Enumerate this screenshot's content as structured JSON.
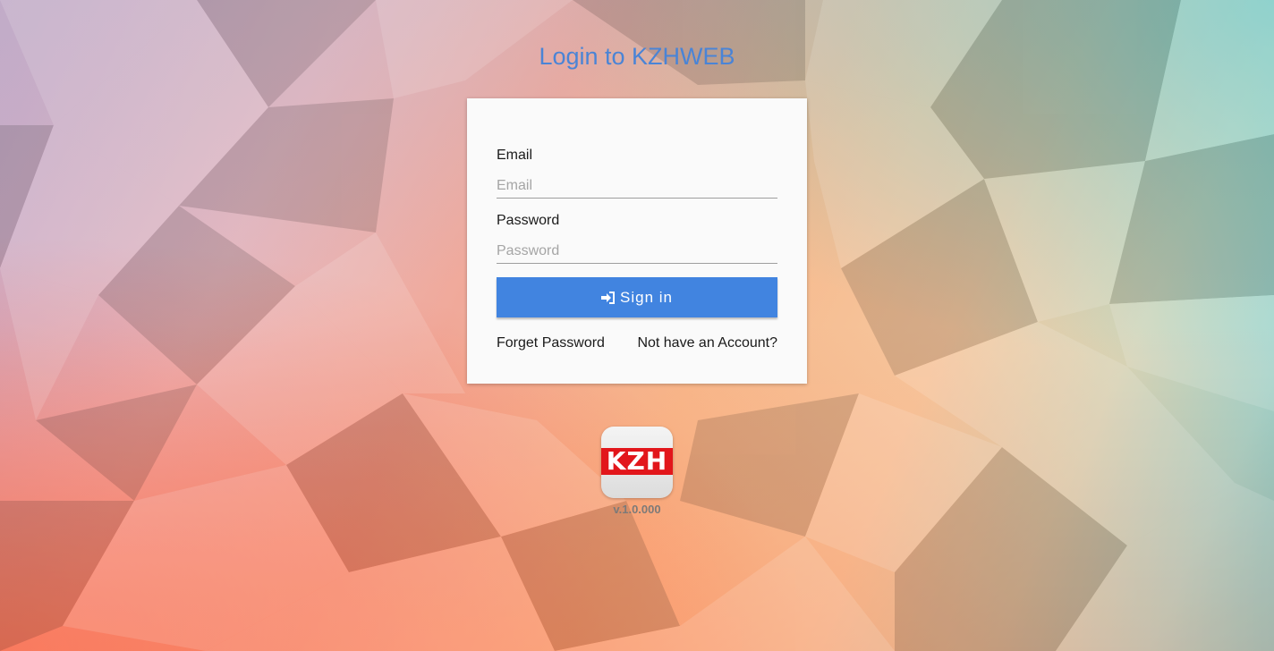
{
  "header": {
    "title": "Login to KZHWEB"
  },
  "login_form": {
    "email_label": "Email",
    "email_placeholder": "Email",
    "email_value": "",
    "password_label": "Password",
    "password_placeholder": "Password",
    "password_value": "",
    "signin_label": "Sign in",
    "signin_icon": "sign-in-icon",
    "forgot_password_link": "Forget Password",
    "signup_link": "Not have an Account?"
  },
  "footer": {
    "logo_text": "KZH",
    "version": "v.1.0.000"
  },
  "colors": {
    "accent": "#4184e0",
    "title": "#4a84d6",
    "logo_red": "#e2161b"
  }
}
